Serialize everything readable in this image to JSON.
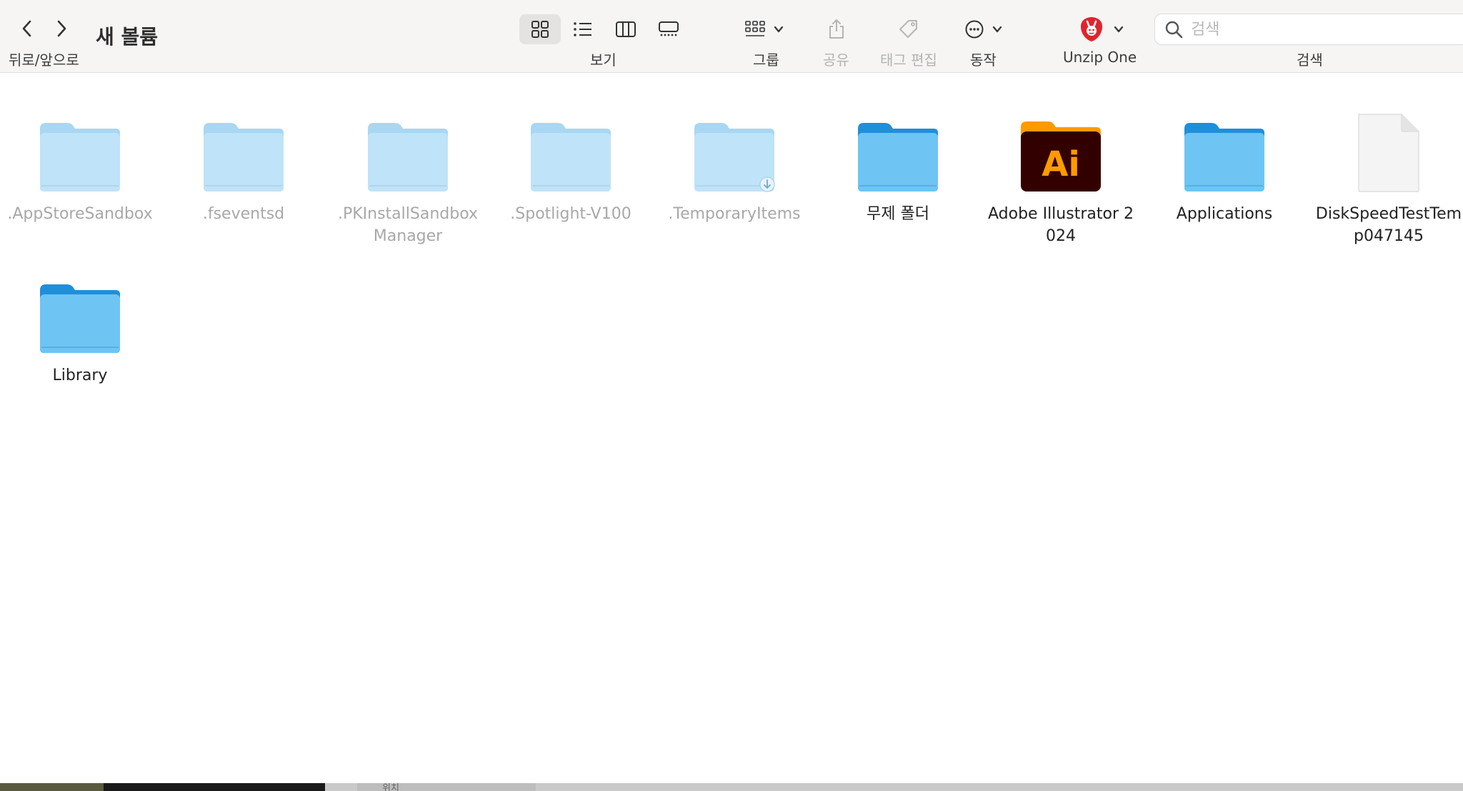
{
  "window": {
    "title": "새 볼륨"
  },
  "toolbar": {
    "back_forward_label": "뒤로/앞으로",
    "view_label": "보기",
    "group_label": "그룹",
    "share_label": "공유",
    "tag_edit_label": "태그 편집",
    "action_label": "동작",
    "unzip_label": "Unzip One",
    "search_label": "검색"
  },
  "search": {
    "placeholder": "검색"
  },
  "colors": {
    "folder_light": "#a8d7f3",
    "folder_dark": "#6ec4f3",
    "ai_orange": "#ff9a00",
    "ai_bg": "#330000",
    "unzip_red": "#e0242c"
  },
  "items": [
    {
      "name": ".AppStoreSandbox",
      "icon": "folder-dim"
    },
    {
      "name": ".fseventsd",
      "icon": "folder-dim"
    },
    {
      "name": ".PKInstallSandboxManager",
      "icon": "folder-dim"
    },
    {
      "name": ".Spotlight-V100",
      "icon": "folder-dim"
    },
    {
      "name": ".TemporaryItems",
      "icon": "folder-dim-download"
    },
    {
      "name": "무제 폴더",
      "icon": "folder"
    },
    {
      "name": "Adobe Illustrator 2024",
      "icon": "illustrator-app"
    },
    {
      "name": "Applications",
      "icon": "folder"
    },
    {
      "name": "DiskSpeedTestTemp047145",
      "icon": "document"
    },
    {
      "name": "Library",
      "icon": "folder"
    }
  ],
  "bottom_strip": {
    "peek_text": "위치"
  }
}
